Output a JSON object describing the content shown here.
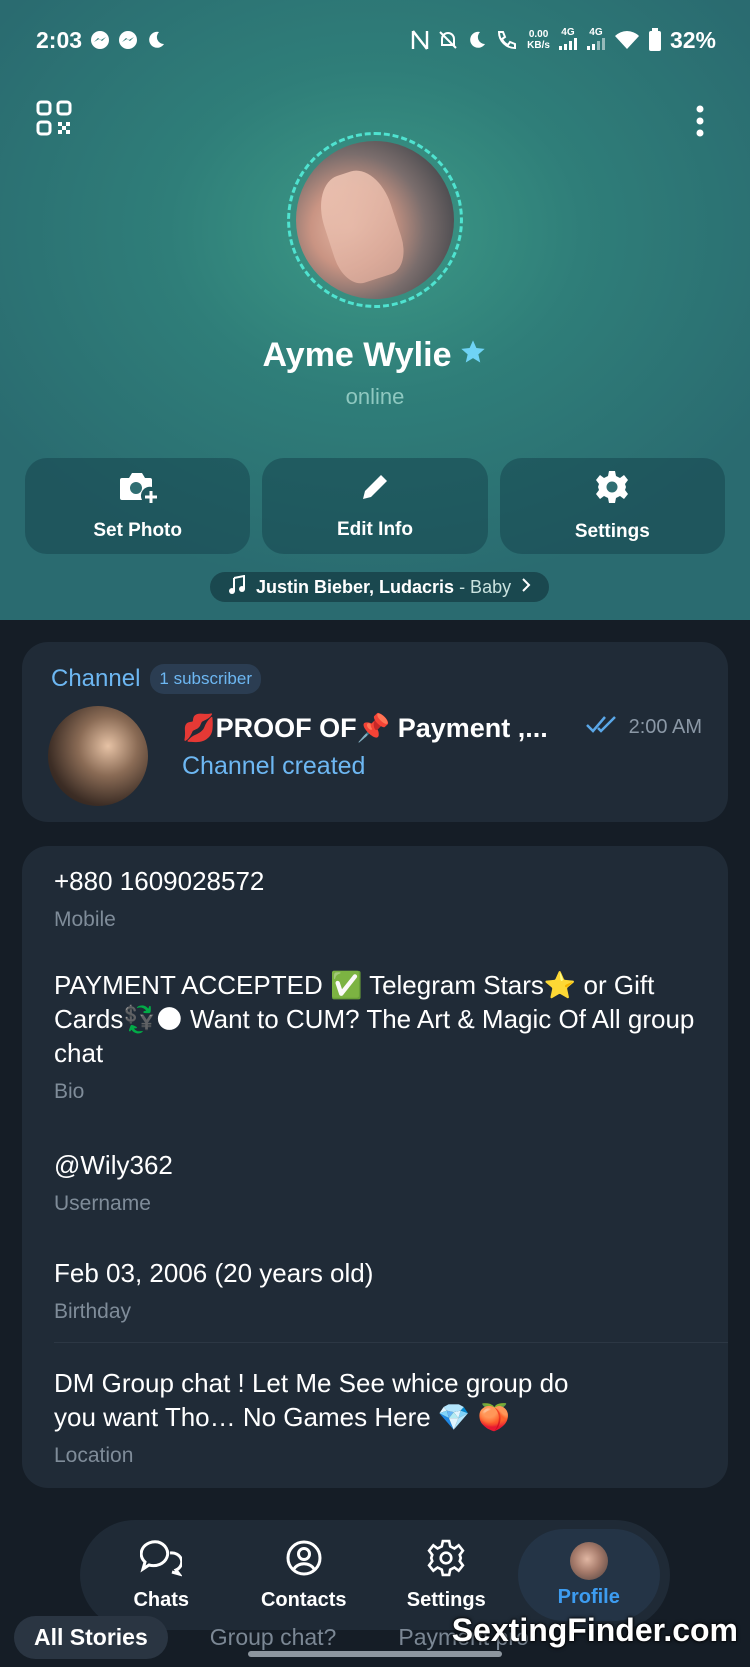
{
  "status_bar": {
    "time": "2:03",
    "net_speed_value": "0.00",
    "net_speed_unit": "KB/s",
    "net1": "4G",
    "net2": "4G",
    "battery": "32%"
  },
  "profile": {
    "name": "Ayme Wylie",
    "status": "online",
    "accent_ring": "#4fe3d0"
  },
  "actions": {
    "set_photo": "Set Photo",
    "edit_info": "Edit Info",
    "settings": "Settings"
  },
  "music": {
    "artist": "Justin Bieber, Ludacris",
    "song": " - Baby"
  },
  "channel": {
    "label": "Channel",
    "subscribers": "1 subscriber",
    "title": "💋PROOF OF📌 Payment ,...",
    "time": "2:00 AM",
    "last_message": "Channel created"
  },
  "info": {
    "phone": "+880 1609028572",
    "phone_label": "Mobile",
    "bio": "PAYMENT ACCEPTED ✅ Telegram Stars⭐ or Gift Cards💱🌑 Want to CUM? The Art & Magic Of All group chat",
    "bio_label": "Bio",
    "username": "@Wily362",
    "username_label": "Username",
    "birthday": "Feb 03, 2006 (20 years old)",
    "birthday_label": "Birthday",
    "location": "DM Group chat ! Let Me See  whice group do you want Tho… No Games Here 💎 🍑",
    "location_label": "Location"
  },
  "nav": {
    "chats": "Chats",
    "contacts": "Contacts",
    "settings": "Settings",
    "profile": "Profile"
  },
  "stories": {
    "all": "All Stories",
    "group": "Group chat?",
    "payment": "Payment pro"
  },
  "watermark": "SextingFinder.com",
  "colors": {
    "link_blue": "#6db7f2",
    "active_nav": "#3d9cf0",
    "card_bg": "#202b37",
    "page_bg": "#151d26"
  }
}
